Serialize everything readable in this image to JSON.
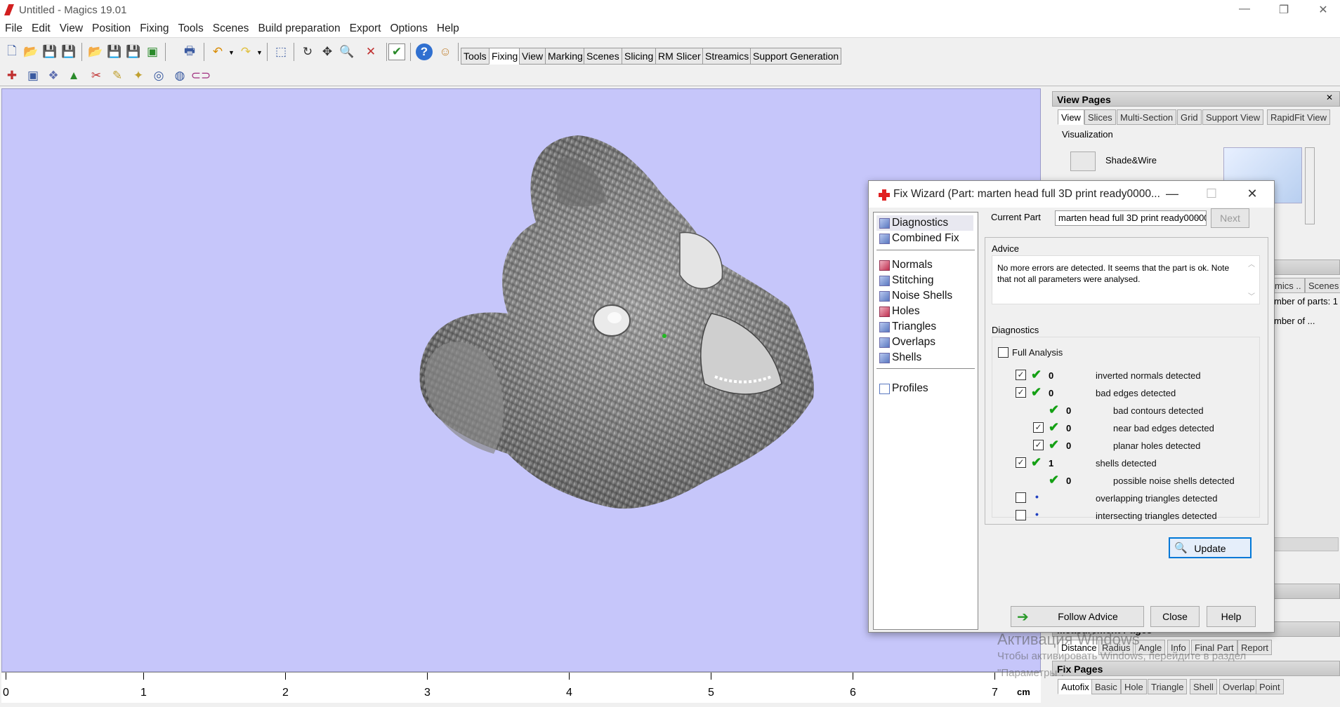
{
  "window": {
    "title": "Untitled - Magics 19.01",
    "controls": [
      "—",
      "❐",
      "✕"
    ]
  },
  "menu": [
    "File",
    "Edit",
    "View",
    "Position",
    "Fixing",
    "Tools",
    "Scenes",
    "Build preparation",
    "Export",
    "Options",
    "Help"
  ],
  "page_tabs": [
    "Tools",
    "Fixing",
    "View",
    "Marking",
    "Scenes",
    "Slicing",
    "RM Slicer",
    "Streamics",
    "Support Generation"
  ],
  "active_page_tab": "Fixing",
  "ruler": {
    "labels": [
      "0",
      "1",
      "2",
      "3",
      "4",
      "5",
      "6",
      "7"
    ],
    "unit": "cm"
  },
  "view_pages": {
    "title": "View Pages",
    "tabs": [
      "View",
      "Slices",
      "Multi-Section",
      "Grid",
      "Support View",
      "RapidFit View"
    ],
    "visualization_label": "Visualization",
    "mode_label": "Shade&Wire"
  },
  "scenes_panel": {
    "tabs": [
      "mics ..",
      "Scenes"
    ],
    "line1": "mber of parts: 1",
    "line2": "mber of ..."
  },
  "measurement_pages": {
    "title": "Measurement Pages",
    "tabs": [
      "Distance",
      "Radius",
      "Angle",
      "Info",
      "Final Part",
      "Report"
    ]
  },
  "fix_pages": {
    "title": "Fix Pages",
    "tabs": [
      "Autofix",
      "Basic",
      "Hole",
      "Triangle",
      "Shell",
      "Overlap",
      "Point"
    ]
  },
  "watermark": {
    "line1": "Активация Windows",
    "line2": "Чтобы активировать Windows, перейдите в раздел",
    "line3": "\"Параметры\"."
  },
  "dialog": {
    "title": "Fix Wizard (Part: marten head full 3D print ready0000...",
    "controls": [
      "—",
      "☐",
      "✕"
    ],
    "nav": {
      "top": [
        {
          "label": "Diagnostics",
          "selected": true
        },
        {
          "label": "Combined Fix"
        }
      ],
      "items": [
        "Normals",
        "Stitching",
        "Noise Shells",
        "Holes",
        "Triangles",
        "Overlaps",
        "Shells"
      ],
      "bottom": "Profiles"
    },
    "current_part_label": "Current Part",
    "current_part_value": "marten head full 3D print ready00000",
    "next_label": "Next",
    "advice_label": "Advice",
    "advice_text": "No more errors are detected. It seems that the part is ok. Note that not all parameters were analysed.",
    "diagnostics_label": "Diagnostics",
    "full_analysis_label": "Full Analysis",
    "rows": [
      {
        "checkbox": true,
        "checked": true,
        "status": "ok",
        "count": "0",
        "label": "inverted normals detected",
        "indent": 0
      },
      {
        "checkbox": true,
        "checked": true,
        "status": "ok",
        "count": "0",
        "label": "bad edges detected",
        "indent": 0
      },
      {
        "checkbox": false,
        "checked": false,
        "status": "ok",
        "count": "0",
        "label": "bad contours detected",
        "indent": 1
      },
      {
        "checkbox": true,
        "checked": true,
        "status": "ok",
        "count": "0",
        "label": "near bad edges detected",
        "indent": 1
      },
      {
        "checkbox": true,
        "checked": true,
        "status": "ok",
        "count": "0",
        "label": "planar holes detected",
        "indent": 1
      },
      {
        "checkbox": true,
        "checked": true,
        "status": "ok",
        "count": "1",
        "label": "shells detected",
        "indent": 0
      },
      {
        "checkbox": false,
        "checked": false,
        "status": "ok",
        "count": "0",
        "label": "possible noise shells detected",
        "indent": 1
      },
      {
        "checkbox": true,
        "checked": false,
        "status": "dot",
        "count": "",
        "label": "overlapping triangles detected",
        "indent": 0
      },
      {
        "checkbox": true,
        "checked": false,
        "status": "dot",
        "count": "",
        "label": "intersecting triangles detected",
        "indent": 0
      }
    ],
    "update_label": "Update",
    "follow_advice_label": "Follow Advice",
    "close_label": "Close",
    "help_label": "Help"
  },
  "colors": {
    "viewport": "#c6c6fa",
    "accent": "#0078d7",
    "check": "#14a014"
  }
}
